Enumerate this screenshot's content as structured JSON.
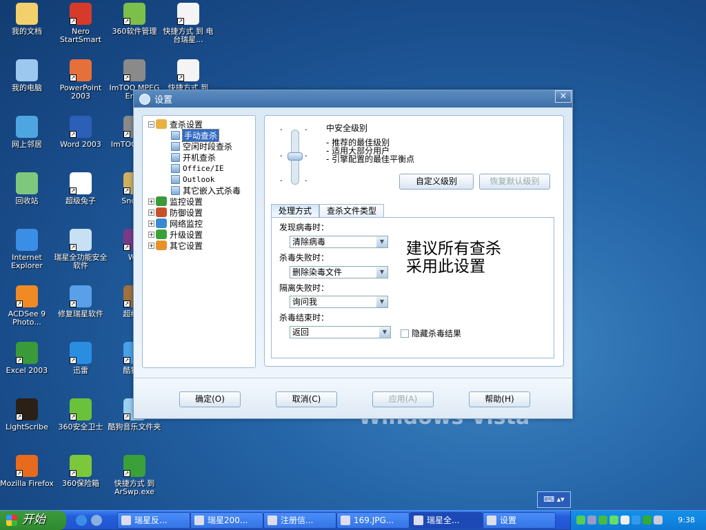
{
  "desktop": {
    "columns": [
      [
        {
          "label": "我的文档",
          "color": "#f2d06b"
        },
        {
          "label": "我的电脑",
          "color": "#9cc8ef"
        },
        {
          "label": "网上邻居",
          "color": "#4ea6e0"
        },
        {
          "label": "回收站",
          "color": "#7ec87e"
        },
        {
          "label": "Internet Explorer",
          "color": "#3a8ee6"
        },
        {
          "label": "ACDSee 9 Photo...",
          "color": "#f08a24"
        },
        {
          "label": "Excel 2003",
          "color": "#3a9a3a"
        },
        {
          "label": "LightScribe",
          "color": "#2a2016"
        },
        {
          "label": "Mozilla Firefox",
          "color": "#e86a1c"
        }
      ],
      [
        {
          "label": "Nero StartSmart",
          "color": "#d63a2a"
        },
        {
          "label": "PowerPoint 2003",
          "color": "#e6703a"
        },
        {
          "label": "Word 2003",
          "color": "#2d5fb8"
        },
        {
          "label": "超级兔子",
          "color": "#ffffff"
        },
        {
          "label": "瑞星全功能安全软件",
          "color": "#c8e0f4"
        },
        {
          "label": "修复瑞星软件",
          "color": "#5aa0e8"
        },
        {
          "label": "迅雷",
          "color": "#2a8ee0"
        },
        {
          "label": "360安全卫士",
          "color": "#6ac23a"
        },
        {
          "label": "360保险箱",
          "color": "#7cc83a"
        }
      ],
      [
        {
          "label": "360软件管理",
          "color": "#7cbf4a"
        },
        {
          "label": "ImTOO MPEG Enco",
          "color": "#8a8a8a"
        },
        {
          "label": "ImTOO Enco",
          "color": "#8a8a8a"
        },
        {
          "label": "SndMa",
          "color": "#d0b060"
        },
        {
          "label": "Wir",
          "color": "#7a3a8a"
        },
        {
          "label": "超级解",
          "color": "#a07040"
        },
        {
          "label": "酷狗音",
          "color": "#4aa0e8"
        },
        {
          "label": "酷狗音乐文件夹",
          "color": "#9ad0f0"
        },
        {
          "label": "快捷方式 到 ArSwp.exe",
          "color": "#3aa03a"
        }
      ],
      [
        {
          "label": "快捷方式 到 电台瑞星...",
          "color": "#f4f4f4"
        },
        {
          "label": "快捷方式 到",
          "color": "#f4f4f4"
        }
      ]
    ],
    "watermark": "Windows Vista"
  },
  "dialog": {
    "title": "设置",
    "close": "×",
    "tree": {
      "root": "查杀设置",
      "children": [
        "手动查杀",
        "空闲时段查杀",
        "开机查杀",
        "Office/IE",
        "Outlook",
        "其它嵌入式杀毒"
      ],
      "others": [
        {
          "label": "监控设置",
          "color": "#3a9a3a"
        },
        {
          "label": "防御设置",
          "color": "#c8502a"
        },
        {
          "label": "网络监控",
          "color": "#3a8ad0"
        },
        {
          "label": "升级设置",
          "color": "#3aa03a"
        },
        {
          "label": "其它设置",
          "color": "#e8902a"
        }
      ]
    },
    "level": {
      "title": "中安全级别",
      "lines": [
        "- 推荐的最佳级别",
        "- 适用大部分用户",
        "- 引擎配置的最佳平衡点"
      ],
      "value": 0.5
    },
    "custom_level": "自定义级别",
    "restore_default": "恢复默认级别",
    "tabs": [
      "处理方式",
      "查杀文件类型"
    ],
    "fields": [
      {
        "label": "发现病毒时：",
        "value": "清除病毒"
      },
      {
        "label": "杀毒失败时：",
        "value": "删除染毒文件"
      },
      {
        "label": "隔离失败时：",
        "value": "询问我"
      },
      {
        "label": "杀毒结束时：",
        "value": "返回"
      }
    ],
    "hint": "建议所有查杀采用此设置",
    "hide_results": "隐藏杀毒结果",
    "buttons": {
      "ok": "确定(O)",
      "cancel": "取消(C)",
      "apply": "应用(A)",
      "help": "帮助(H)"
    }
  },
  "taskbar": {
    "start": "开始",
    "tasks": [
      "瑞星反...",
      "瑞星200...",
      "注册信...",
      "169.JPG...",
      "瑞星全...",
      "设置"
    ],
    "clock": "9:38",
    "lang": "⌨ ▴▾"
  }
}
